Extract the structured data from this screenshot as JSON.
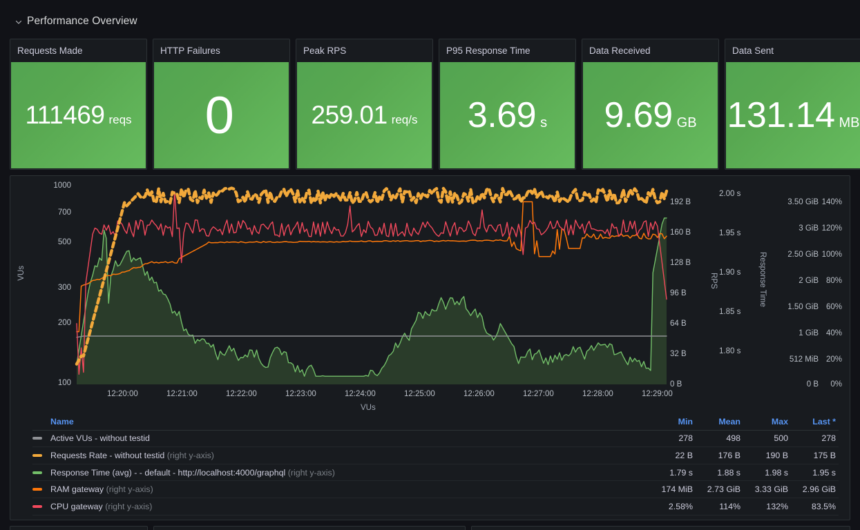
{
  "row": {
    "title": "Performance Overview",
    "collapse_icon": "chevron-down-icon"
  },
  "stats": [
    {
      "title": "Requests Made",
      "value": "111469",
      "unit": "reqs",
      "size": "normal",
      "color": "#56a64b"
    },
    {
      "title": "HTTP Failures",
      "value": "0",
      "unit": "",
      "size": "huge",
      "color": "#56a64b"
    },
    {
      "title": "Peak RPS",
      "value": "259.01",
      "unit": "req/s",
      "size": "normal",
      "color": "#56a64b"
    },
    {
      "title": "P95 Response Time",
      "value": "3.69",
      "unit": "s",
      "size": "big",
      "color": "#56a64b"
    },
    {
      "title": "Data Received",
      "value": "9.69",
      "unit": "GB",
      "size": "big",
      "color": "#56a64b"
    },
    {
      "title": "Data Sent",
      "value": "131.14",
      "unit": "MB",
      "size": "big",
      "color": "#56a64b"
    }
  ],
  "chart_data": {
    "type": "line",
    "title": "",
    "xlabel": "VUs",
    "x_ticks": [
      "12:20:00",
      "12:21:00",
      "12:22:00",
      "12:23:00",
      "12:24:00",
      "12:25:00",
      "12:26:00",
      "12:27:00",
      "12:28:00",
      "12:29:00"
    ],
    "grid": false,
    "legend_position": "bottom-table",
    "axes": [
      {
        "id": "left-vus",
        "side": "left",
        "label": "VUs",
        "scale": "log",
        "ticks": [
          "1000",
          "700",
          "500",
          "300",
          "200",
          "100"
        ],
        "ylim": [
          100,
          1000
        ]
      },
      {
        "id": "right-bytes",
        "side": "right",
        "label": "RPS",
        "scale": "linear",
        "ticks": [
          "192 B",
          "160 B",
          "128 B",
          "96 B",
          "64 B",
          "32 B",
          "0 B"
        ],
        "ylim": [
          0,
          192
        ]
      },
      {
        "id": "right-seconds",
        "side": "right",
        "label": "Response Time",
        "scale": "linear",
        "ticks": [
          "2.00 s",
          "1.95 s",
          "1.90 s",
          "1.85 s",
          "1.80 s"
        ],
        "ylim": [
          1.8,
          2.0
        ]
      },
      {
        "id": "right-bytes-big",
        "side": "right",
        "label": "",
        "scale": "linear",
        "ticks": [
          "3.50 GiB",
          "3 GiB",
          "2.50 GiB",
          "2 GiB",
          "1.50 GiB",
          "1 GiB",
          "512 MiB",
          "0 B"
        ],
        "ylim": [
          0,
          3.5
        ]
      },
      {
        "id": "right-percent",
        "side": "right",
        "label": "",
        "scale": "linear",
        "ticks": [
          "140%",
          "120%",
          "100%",
          "80%",
          "60%",
          "40%",
          "20%",
          "0%"
        ],
        "ylim": [
          0,
          140
        ]
      }
    ],
    "series": [
      {
        "name": "Active VUs - without testid",
        "color": "#8f9195",
        "style": "solid",
        "axis": "left-vus",
        "fill": false
      },
      {
        "name": "Requests Rate - without testid",
        "color": "#f2a93b",
        "style": "dashed",
        "axis": "right-bytes",
        "fill": false
      },
      {
        "name": "Response Time (avg) - - default - http://localhost:4000/graphql",
        "color": "#73bf69",
        "style": "solid",
        "axis": "right-seconds",
        "fill": true
      },
      {
        "name": "RAM gateway",
        "color": "#ff780a",
        "style": "solid",
        "axis": "right-bytes-big",
        "fill": false
      },
      {
        "name": "CPU gateway",
        "color": "#f2495c",
        "style": "solid",
        "axis": "right-percent",
        "fill": false
      }
    ]
  },
  "legend": {
    "columns": [
      "Name",
      "Min",
      "Mean",
      "Max",
      "Last *"
    ],
    "rows": [
      {
        "color": "#8f9195",
        "name": "Active VUs - without testid",
        "axis_note": "",
        "min": "278",
        "mean": "498",
        "max": "500",
        "last": "278"
      },
      {
        "color": "#f2a93b",
        "name": "Requests Rate - without testid",
        "axis_note": "(right y-axis)",
        "min": "22 B",
        "mean": "176 B",
        "max": "190 B",
        "last": "175 B"
      },
      {
        "color": "#73bf69",
        "name": "Response Time (avg) - - default - http://localhost:4000/graphql",
        "axis_note": "(right y-axis)",
        "min": "1.79 s",
        "mean": "1.88 s",
        "max": "1.98 s",
        "last": "1.95 s"
      },
      {
        "color": "#ff780a",
        "name": "RAM gateway",
        "axis_note": "(right y-axis)",
        "min": "174 MiB",
        "mean": "2.73 GiB",
        "max": "3.33 GiB",
        "last": "2.96 GiB"
      },
      {
        "color": "#f2495c",
        "name": "CPU gateway",
        "axis_note": "(right y-axis)",
        "min": "2.58%",
        "mean": "114%",
        "max": "132%",
        "last": "83.5%"
      }
    ]
  }
}
